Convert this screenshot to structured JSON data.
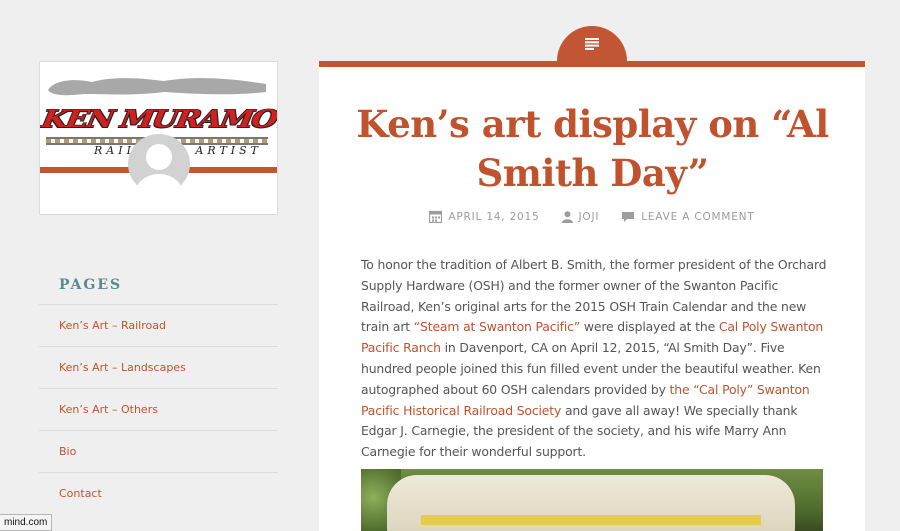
{
  "sidebar": {
    "logo": {
      "brand_text": "KEN MURAMOTO",
      "subtitle_text": "RAILROAD ARTIST",
      "colors": {
        "brand_red": "#d21f1f",
        "bar": "#c25634"
      }
    },
    "pages_title": "PAGES",
    "pages": [
      {
        "label": "Ken’s Art – Railroad"
      },
      {
        "label": "Ken’s Art – Landscapes"
      },
      {
        "label": "Ken’s Art – Others"
      },
      {
        "label": "Bio"
      },
      {
        "label": "Contact"
      }
    ]
  },
  "status_bar": {
    "text": "mind.com"
  },
  "post": {
    "format_icon": "lines-icon",
    "title": "Ken’s art display on “Al Smith Day”",
    "meta": {
      "date": "APRIL 14, 2015",
      "author": "JOJI",
      "comment": "LEAVE A COMMENT"
    },
    "body": {
      "p1": "To honor the tradition of Albert B. Smith, the former president of the Orchard Supply Hardware (OSH) and the former owner of the Swanton Pacific Railroad, Ken’s original arts for the 2015 OSH Train Calendar and the new train art ",
      "link1": "“Steam at Swanton Pacific”",
      "p2": " were displayed at the ",
      "link2": "Cal Poly Swanton Pacific Ranch",
      "p3": " in Davenport, CA on April 12, 2015, “Al Smith Day”. Five hundred people joined this fun filled event under the beautiful weather. Ken autographed about 60 OSH calendars provided by ",
      "link3": "the “Cal Poly” Swanton Pacific Historical Railroad Society",
      "p4": " and gave all away! We specially thank Edgar J. Carnegie, the president of the society, and his wife Marry Ann Carnegie for their wonderful support."
    }
  },
  "colors": {
    "accent": "#c25634",
    "link": "#c0532e",
    "pages_heading": "#5a8a8e",
    "text": "#555555",
    "meta": "#9c9c9c"
  }
}
